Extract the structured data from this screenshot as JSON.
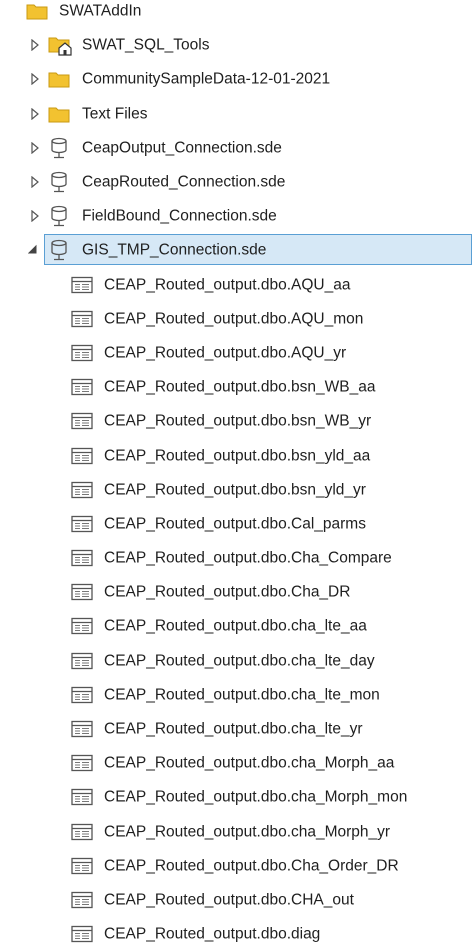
{
  "tree": {
    "root": {
      "label": "SWATAddIn",
      "icon": "folder-icon"
    },
    "children": [
      {
        "label": "SWAT_SQL_Tools",
        "icon": "home-folder-icon",
        "expanded": false
      },
      {
        "label": "CommunitySampleData-12-01-2021",
        "icon": "folder-icon",
        "expanded": false
      },
      {
        "label": "Text Files",
        "icon": "folder-icon",
        "expanded": false
      },
      {
        "label": "CeapOutput_Connection.sde",
        "icon": "database-connection-icon",
        "expanded": false
      },
      {
        "label": "CeapRouted_Connection.sde",
        "icon": "database-connection-icon",
        "expanded": false
      },
      {
        "label": "FieldBound_Connection.sde",
        "icon": "database-connection-icon",
        "expanded": false
      },
      {
        "label": "GIS_TMP_Connection.sde",
        "icon": "database-connection-icon",
        "expanded": true,
        "selected": true
      }
    ],
    "tables": [
      "CEAP_Routed_output.dbo.AQU_aa",
      "CEAP_Routed_output.dbo.AQU_mon",
      "CEAP_Routed_output.dbo.AQU_yr",
      "CEAP_Routed_output.dbo.bsn_WB_aa",
      "CEAP_Routed_output.dbo.bsn_WB_yr",
      "CEAP_Routed_output.dbo.bsn_yld_aa",
      "CEAP_Routed_output.dbo.bsn_yld_yr",
      "CEAP_Routed_output.dbo.Cal_parms",
      "CEAP_Routed_output.dbo.Cha_Compare",
      "CEAP_Routed_output.dbo.Cha_DR",
      "CEAP_Routed_output.dbo.cha_lte_aa",
      "CEAP_Routed_output.dbo.cha_lte_day",
      "CEAP_Routed_output.dbo.cha_lte_mon",
      "CEAP_Routed_output.dbo.cha_lte_yr",
      "CEAP_Routed_output.dbo.cha_Morph_aa",
      "CEAP_Routed_output.dbo.cha_Morph_mon",
      "CEAP_Routed_output.dbo.cha_Morph_yr",
      "CEAP_Routed_output.dbo.Cha_Order_DR",
      "CEAP_Routed_output.dbo.CHA_out",
      "CEAP_Routed_output.dbo.diag"
    ],
    "colors": {
      "folder": "#f2c230",
      "selection_bg": "#d6e8f6",
      "selection_border": "#5a9fd4",
      "icon_stroke": "#555555"
    }
  }
}
